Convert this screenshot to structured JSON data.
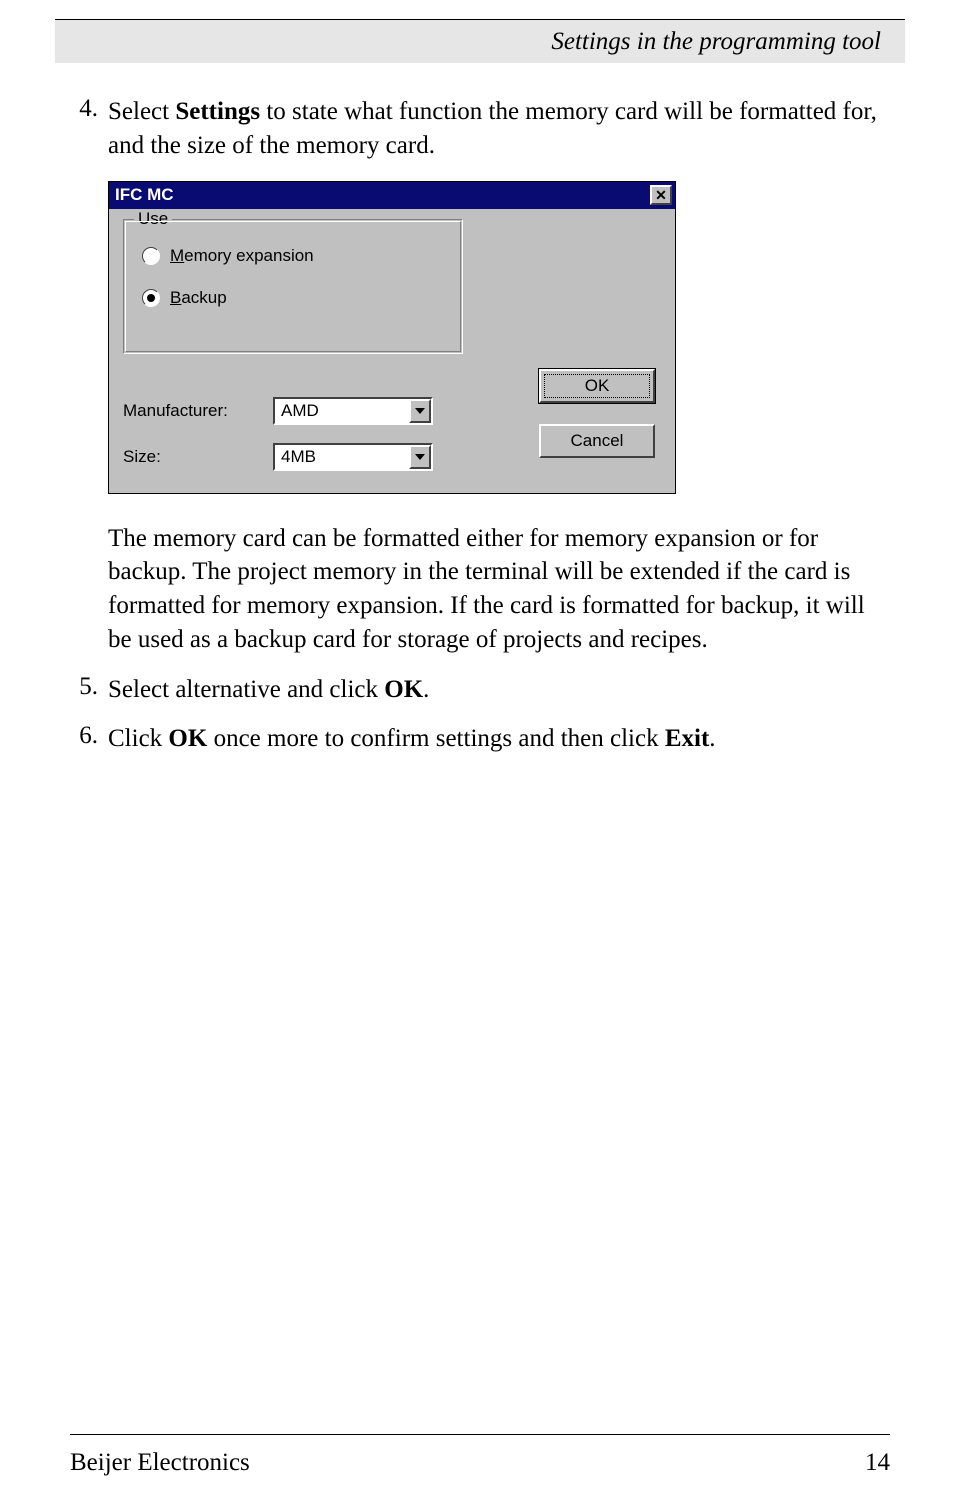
{
  "header": {
    "title": "Settings in the programming tool"
  },
  "steps": {
    "s4": {
      "num": "4.",
      "pre": "Select ",
      "bold": "Settings",
      "post": " to state what function the memory card will be formatted for, and the size of the memory card."
    },
    "s5": {
      "num": "5.",
      "pre": "Select alternative and click ",
      "bold": "OK",
      "post": "."
    },
    "s6": {
      "num": "6.",
      "pre": "Click ",
      "bold1": "OK",
      "mid": " once more to confirm settings and then click ",
      "bold2": "Exit",
      "post": "."
    }
  },
  "para1": "The memory card can be formatted either for memory expansion or for backup. The project memory in the terminal will be extended if the card is formatted for memory expansion. If the card is formatted for backup, it will be used as a backup card for storage of projects and recipes.",
  "dialog": {
    "title": "IFC MC",
    "group": "Use",
    "opt1_first": "M",
    "opt1_rest": "emory expansion",
    "opt2_first": "B",
    "opt2_rest": "ackup",
    "manufacturer_label": "Manufacturer:",
    "manufacturer_value": "AMD",
    "size_label": "Size:",
    "size_value": "4MB",
    "ok": "OK",
    "cancel": "Cancel"
  },
  "footer": {
    "left": "Beijer Electronics",
    "right": "14"
  }
}
